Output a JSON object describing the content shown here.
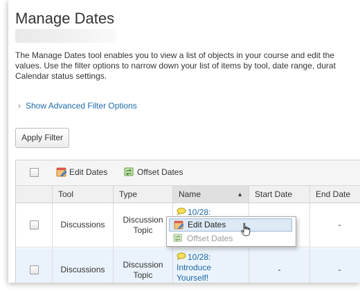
{
  "page": {
    "title": "Manage Dates",
    "description_lines": [
      "The Manage Dates tool enables you to view a list of objects in your course and edit the",
      "values. Use the filter options to narrow down your list of items by tool, date range, durat",
      "Calendar status settings."
    ]
  },
  "filter": {
    "advanced_label": "Show Advanced Filter Options",
    "apply_label": "Apply Filter"
  },
  "toolbar": {
    "edit_dates": "Edit Dates",
    "offset_dates": "Offset Dates"
  },
  "table": {
    "columns": [
      "Tool",
      "Type",
      "Name",
      "Start Date",
      "End Date"
    ],
    "sorted_column": "Name",
    "rows": [
      {
        "tool": "Discussions",
        "type": [
          "Discussion",
          "Topic"
        ],
        "name": [
          "10/28:"
        ],
        "start": "",
        "end": "-"
      },
      {
        "tool": "Discussions",
        "type": [
          "Discussion",
          "Topic"
        ],
        "name": [
          "10/28:",
          "Introduce",
          "Yourself!"
        ],
        "start": "-",
        "end": "-"
      }
    ]
  },
  "context_menu": {
    "items": [
      {
        "label": "Edit Dates",
        "state": "highlighted"
      },
      {
        "label": "Offset Dates",
        "state": "disabled"
      }
    ]
  },
  "icons": {
    "edit": "edit-dates-icon",
    "offset": "offset-dates-icon",
    "discussion": "discussion-topic-icon"
  },
  "colors": {
    "link": "#1e6aa8",
    "row_alt": "#eaf3fb",
    "menu_highlight": "#dde9f5"
  }
}
